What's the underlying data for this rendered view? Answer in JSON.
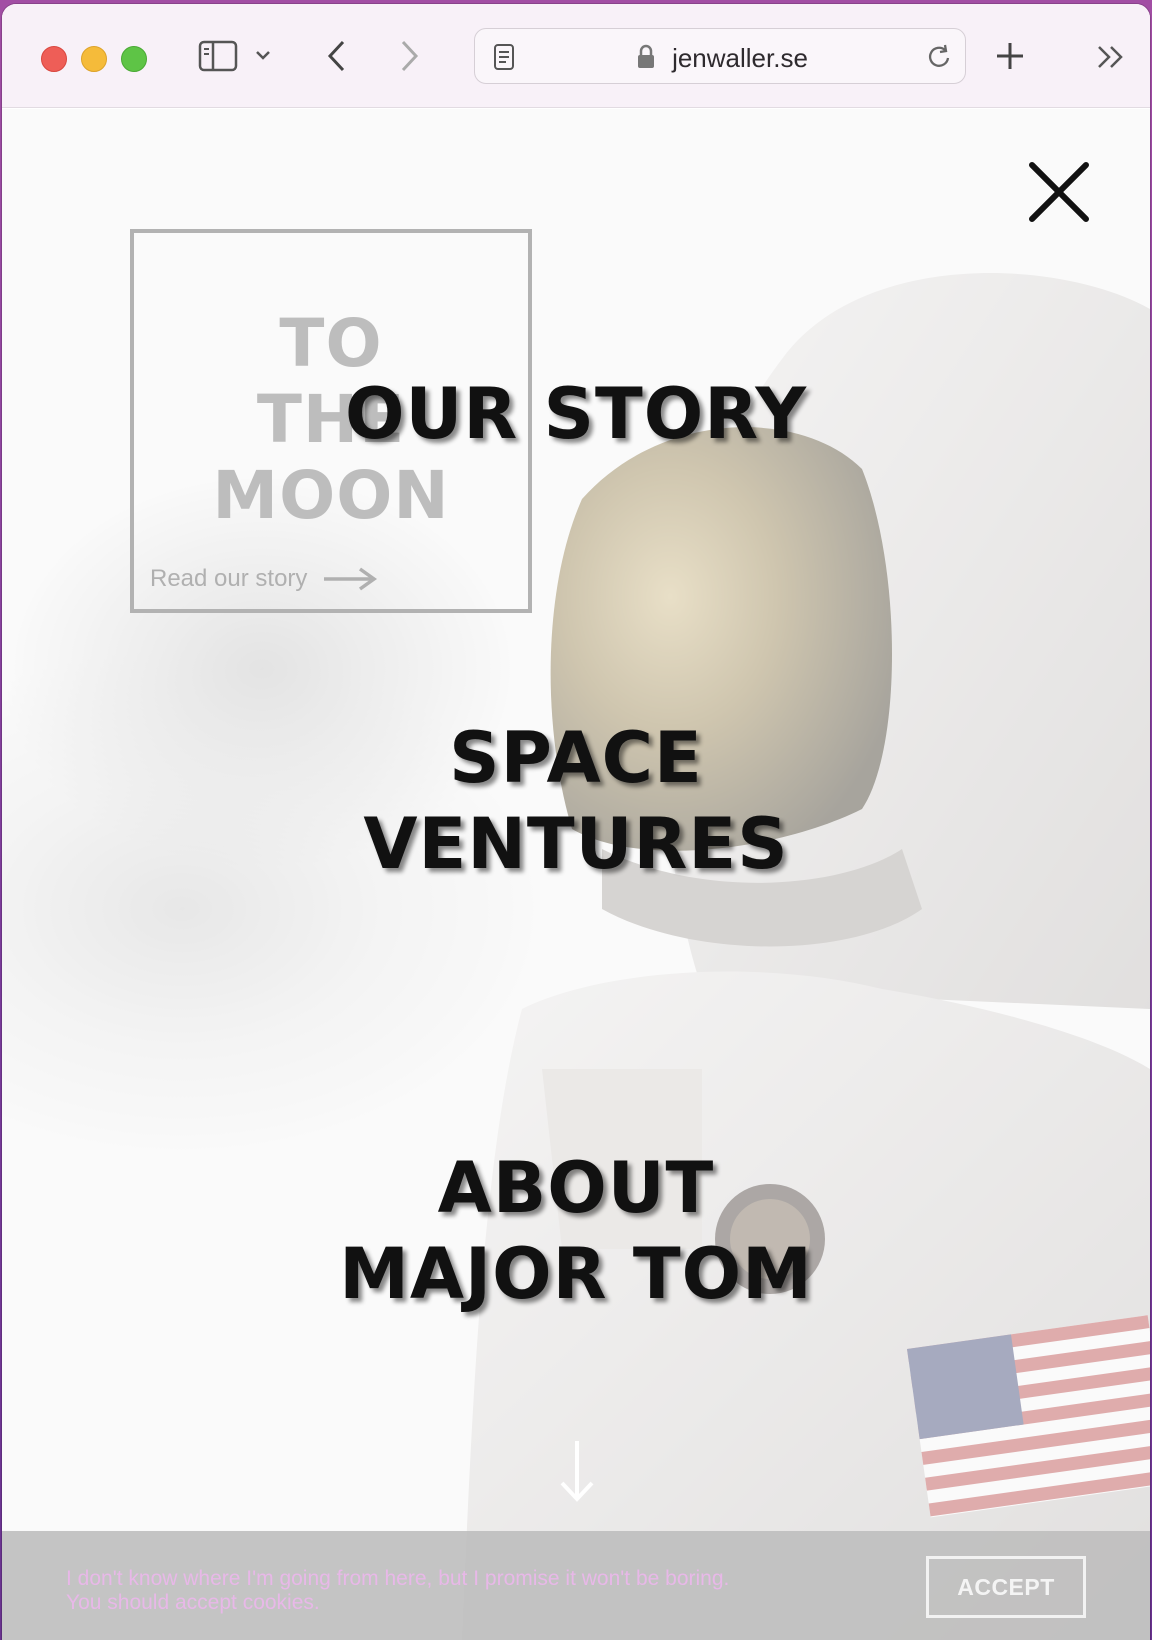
{
  "browser": {
    "url": "jenwaller.se",
    "icons": [
      "sidebar-icon",
      "chevron-down-icon",
      "back-icon",
      "forward-icon",
      "reader-icon",
      "lock-icon",
      "reload-icon",
      "new-tab-icon",
      "more-icon"
    ]
  },
  "hero": {
    "title_line1": "TO",
    "title_line2": "THE",
    "title_line3": "MOON",
    "link_label": "Read our story"
  },
  "menu": {
    "items": [
      {
        "line1": "OUR STORY",
        "line2": ""
      },
      {
        "line1": "SPACE",
        "line2": "VENTURES"
      },
      {
        "line1": "ABOUT",
        "line2": "MAJOR TOM"
      }
    ]
  },
  "cookie": {
    "text": "I don't know where I'm going from here, but I promise it won't be boring. You should accept cookies.",
    "accept_label": "ACCEPT"
  },
  "colors": {
    "cookie_text": "#e8b8e8",
    "menu_text": "#111111",
    "desktop_bg": "#a24ea4"
  }
}
